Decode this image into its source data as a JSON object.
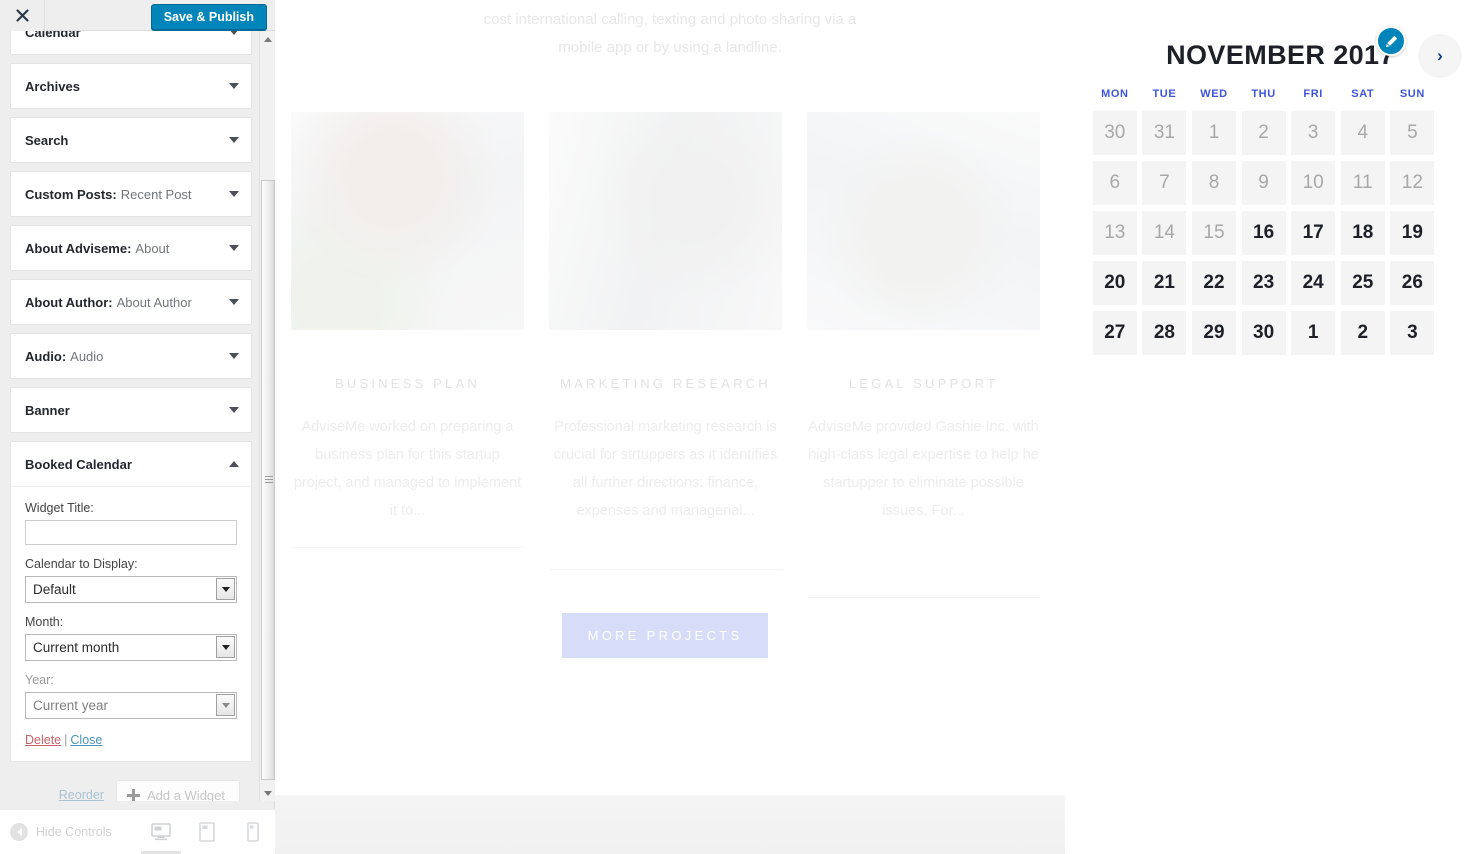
{
  "customizer": {
    "close_label": "Close Customizer",
    "publish_label": "Save & Publish",
    "widgets": [
      {
        "type": "",
        "name": "Calendar",
        "state": "collapsed"
      },
      {
        "type": "",
        "name": "Archives",
        "state": "collapsed"
      },
      {
        "type": "",
        "name": "Search",
        "state": "collapsed"
      },
      {
        "type": "Custom Posts:",
        "name": "Recent Post",
        "state": "collapsed"
      },
      {
        "type": "About Adviseme:",
        "name": "About",
        "state": "collapsed"
      },
      {
        "type": "About Author:",
        "name": "About Author",
        "state": "collapsed"
      },
      {
        "type": "Audio:",
        "name": "Audio",
        "state": "collapsed"
      },
      {
        "type": "",
        "name": "Banner",
        "state": "collapsed"
      },
      {
        "type": "",
        "name": "Booked Calendar",
        "state": "expanded"
      }
    ],
    "booked_form": {
      "widget_title_label": "Widget Title:",
      "widget_title_value": "",
      "widget_title_placeholder": "",
      "calendar_label": "Calendar to Display:",
      "calendar_value": "Default",
      "calendar_options": [
        "Default"
      ],
      "month_label": "Month:",
      "month_value": "Current month",
      "month_options": [
        "Current month"
      ],
      "year_label": "Year:",
      "year_value": "Current year",
      "year_options": [
        "Current year"
      ],
      "delete_label": "Delete",
      "separator": "|",
      "close_label": "Close"
    },
    "reorder_label": "Reorder",
    "add_widget_label": "Add a Widget",
    "hide_controls_label": "Hide Controls",
    "devices": [
      {
        "name": "desktop",
        "active": true
      },
      {
        "name": "tablet",
        "active": false
      },
      {
        "name": "mobile",
        "active": false
      }
    ]
  },
  "preview": {
    "intro_lines": [
      "cost international calling, texting and photo sharing via a",
      "mobile app or by using a landline."
    ],
    "columns": [
      {
        "image": "man-on-phone-photo",
        "title": "BUSINESS PLAN",
        "body": "AdviseMe worked on preparing a business plan for this startup project, and managed to implement it to..."
      },
      {
        "image": "office-meeting-photo",
        "title": "MARKETING RESEARCH",
        "body": "Professional marketing research is crucial for strtuppers as it identifies all further directions: finance, expenses and managerial..."
      },
      {
        "image": "handshake-photo",
        "title": "LEGAL SUPPORT",
        "body": "AdviseMe provided Gashie Inc. with high-class legal expertise to help he startupper to eliminate possible issues. For..."
      }
    ],
    "more_button_label": "MORE PROJECTS"
  },
  "booked_calendar": {
    "edit_shortcut_name": "pencil-icon",
    "month_title": "NOVEMBER 2017",
    "next_label": "›",
    "weekdays": [
      "MON",
      "TUE",
      "WED",
      "THU",
      "FRI",
      "SAT",
      "SUN"
    ],
    "weeks": [
      [
        {
          "n": "30",
          "avail": false
        },
        {
          "n": "31",
          "avail": false
        },
        {
          "n": "1",
          "avail": false
        },
        {
          "n": "2",
          "avail": false
        },
        {
          "n": "3",
          "avail": false
        },
        {
          "n": "4",
          "avail": false
        },
        {
          "n": "5",
          "avail": false
        }
      ],
      [
        {
          "n": "6",
          "avail": false
        },
        {
          "n": "7",
          "avail": false
        },
        {
          "n": "8",
          "avail": false
        },
        {
          "n": "9",
          "avail": false
        },
        {
          "n": "10",
          "avail": false
        },
        {
          "n": "11",
          "avail": false
        },
        {
          "n": "12",
          "avail": false
        }
      ],
      [
        {
          "n": "13",
          "avail": false
        },
        {
          "n": "14",
          "avail": false
        },
        {
          "n": "15",
          "avail": false
        },
        {
          "n": "16",
          "avail": true
        },
        {
          "n": "17",
          "avail": true
        },
        {
          "n": "18",
          "avail": true
        },
        {
          "n": "19",
          "avail": true
        }
      ],
      [
        {
          "n": "20",
          "avail": true
        },
        {
          "n": "21",
          "avail": true
        },
        {
          "n": "22",
          "avail": true
        },
        {
          "n": "23",
          "avail": true
        },
        {
          "n": "24",
          "avail": true
        },
        {
          "n": "25",
          "avail": true
        },
        {
          "n": "26",
          "avail": true
        }
      ],
      [
        {
          "n": "27",
          "avail": true
        },
        {
          "n": "28",
          "avail": true
        },
        {
          "n": "29",
          "avail": true
        },
        {
          "n": "30",
          "avail": true
        },
        {
          "n": "1",
          "avail": true
        },
        {
          "n": "2",
          "avail": true
        },
        {
          "n": "3",
          "avail": true
        }
      ]
    ]
  },
  "colors": {
    "accent_blue": "#0085ba",
    "weekday_blue": "#3f55d9",
    "button_periwinkle": "#d7ddf8",
    "delete_red": "#c9626b"
  }
}
